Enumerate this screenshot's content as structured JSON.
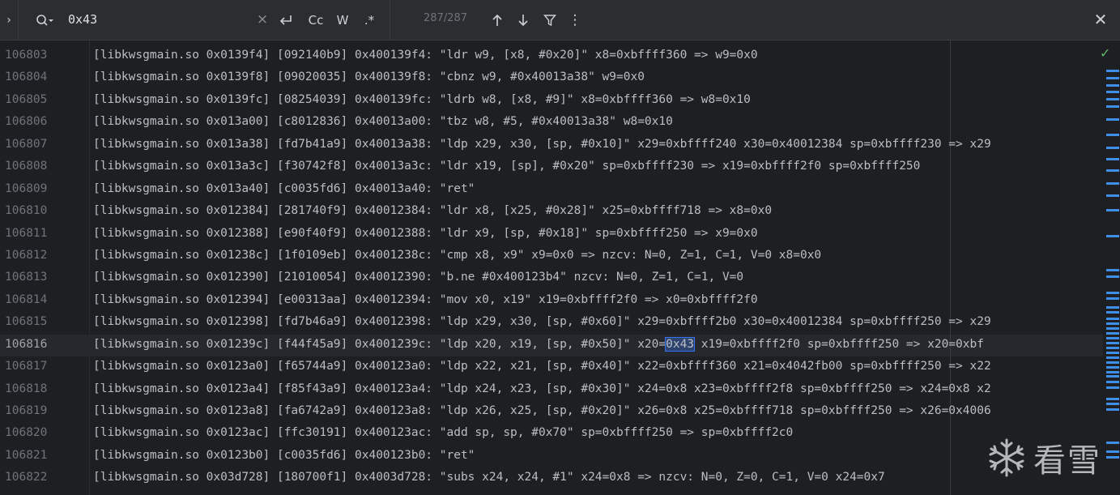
{
  "search": {
    "query": "0x43",
    "match_counter": "287/287",
    "options": {
      "case": "Cc",
      "word": "W",
      "regex": ".*"
    }
  },
  "editor": {
    "current_line_index": 13,
    "lines": [
      {
        "num": "106803",
        "text": "[libkwsgmain.so 0x0139f4] [092140b9] 0x400139f4: \"ldr w9, [x8, #0x20]\" x8=0xbffff360 => w9=0x0"
      },
      {
        "num": "106804",
        "text": "[libkwsgmain.so 0x0139f8] [09020035] 0x400139f8: \"cbnz w9, #0x40013a38\" w9=0x0"
      },
      {
        "num": "106805",
        "text": "[libkwsgmain.so 0x0139fc] [08254039] 0x400139fc: \"ldrb w8, [x8, #9]\" x8=0xbffff360 => w8=0x10"
      },
      {
        "num": "106806",
        "text": "[libkwsgmain.so 0x013a00] [c8012836] 0x40013a00: \"tbz w8, #5, #0x40013a38\" w8=0x10"
      },
      {
        "num": "106807",
        "text": "[libkwsgmain.so 0x013a38] [fd7b41a9] 0x40013a38: \"ldp x29, x30, [sp, #0x10]\" x29=0xbffff240 x30=0x40012384 sp=0xbffff230 => x29"
      },
      {
        "num": "106808",
        "text": "[libkwsgmain.so 0x013a3c] [f30742f8] 0x40013a3c: \"ldr x19, [sp], #0x20\" sp=0xbffff230 => x19=0xbffff2f0 sp=0xbffff250"
      },
      {
        "num": "106809",
        "text": "[libkwsgmain.so 0x013a40] [c0035fd6] 0x40013a40: \"ret\""
      },
      {
        "num": "106810",
        "text": "[libkwsgmain.so 0x012384] [281740f9] 0x40012384: \"ldr x8, [x25, #0x28]\" x25=0xbffff718 => x8=0x0"
      },
      {
        "num": "106811",
        "text": "[libkwsgmain.so 0x012388] [e90f40f9] 0x40012388: \"ldr x9, [sp, #0x18]\" sp=0xbffff250 => x9=0x0"
      },
      {
        "num": "106812",
        "text": "[libkwsgmain.so 0x01238c] [1f0109eb] 0x4001238c: \"cmp x8, x9\" x9=0x0 => nzcv: N=0, Z=1, C=1, V=0 x8=0x0"
      },
      {
        "num": "106813",
        "text": "[libkwsgmain.so 0x012390] [21010054] 0x40012390: \"b.ne #0x400123b4\" nzcv: N=0, Z=1, C=1, V=0"
      },
      {
        "num": "106814",
        "text": "[libkwsgmain.so 0x012394] [e00313aa] 0x40012394: \"mov x0, x19\" x19=0xbffff2f0 => x0=0xbffff2f0"
      },
      {
        "num": "106815",
        "text": "[libkwsgmain.so 0x012398] [fd7b46a9] 0x40012398: \"ldp x29, x30, [sp, #0x60]\" x29=0xbffff2b0 x30=0x40012384 sp=0xbffff250 => x29"
      },
      {
        "num": "106816",
        "text_before": "[libkwsgmain.so 0x01239c] [f44f45a9] 0x4001239c: \"ldp x20, x19, [sp, #0x50]\" x20=",
        "match": "0x43",
        "text_after": " x19=0xbffff2f0 sp=0xbffff250 => x20=0xbf"
      },
      {
        "num": "106817",
        "text": "[libkwsgmain.so 0x0123a0] [f65744a9] 0x400123a0: \"ldp x22, x21, [sp, #0x40]\" x22=0xbffff360 x21=0x4042fb00 sp=0xbffff250 => x22"
      },
      {
        "num": "106818",
        "text": "[libkwsgmain.so 0x0123a4] [f85f43a9] 0x400123a4: \"ldp x24, x23, [sp, #0x30]\" x24=0x8 x23=0xbffff2f8 sp=0xbffff250 => x24=0x8 x2"
      },
      {
        "num": "106819",
        "text": "[libkwsgmain.so 0x0123a8] [fa6742a9] 0x400123a8: \"ldp x26, x25, [sp, #0x20]\" x26=0x8 x25=0xbffff718 sp=0xbffff250 => x26=0x4006"
      },
      {
        "num": "106820",
        "text": "[libkwsgmain.so 0x0123ac] [ffc30191] 0x400123ac: \"add sp, sp, #0x70\" sp=0xbffff250 => sp=0xbffff2c0"
      },
      {
        "num": "106821",
        "text": "[libkwsgmain.so 0x0123b0] [c0035fd6] 0x400123b0: \"ret\""
      },
      {
        "num": "106822",
        "text": "[libkwsgmain.so 0x03d728] [180700f1] 0x4003d728: \"subs x24, x24, #1\" x24=0x8 => nzcv: N=0, Z=0, C=1, V=0 x24=0x7"
      }
    ]
  },
  "colors": {
    "background": "#1e1f22",
    "toolbar": "#2b2d30",
    "match_outline": "#3574f0",
    "scroll_marker": "#3d8ee6",
    "check": "#5fb865"
  },
  "watermark": {
    "text": "看雪",
    "icon": "snowflake-icon"
  }
}
